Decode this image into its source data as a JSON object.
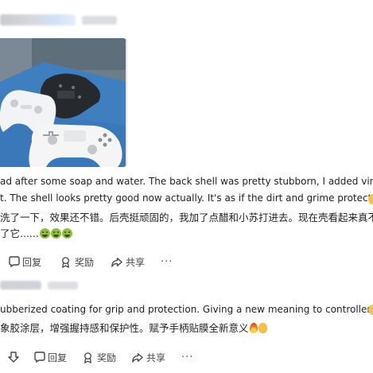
{
  "post1": {
    "text_en_line1": "ad after some soap and water. The back shell was pretty stubborn, I added vinegar an",
    "text_en_line2": "t. The shell looks pretty good now actually. It's as if the dirt and grime protected it...",
    "text_cn_line1": "洗了一下，效果还不错。后壳挺顽固的，我加了点醋和小苏打进去。现在壳看起来真不",
    "text_cn_line2": "了它......",
    "actions": {
      "like_label": "",
      "reply_label": "回复",
      "award_label": "奖励",
      "share_label": "共享",
      "more_label": "···"
    }
  },
  "post2": {
    "text_en": "ubberized coating for grip and protection. Giving a new meaning to controller skin",
    "text_cn": "象胶涂层，增强握持感和保护性。赋予手柄贴膜全新意义",
    "actions": {
      "like_label": "",
      "reply_label": "回复",
      "award_label": "奖励",
      "share_label": "共享",
      "more_label": "···"
    }
  },
  "icons": {
    "comment": "comment-icon",
    "downvote": "downvote-icon",
    "award": "award-icon",
    "share": "share-icon"
  },
  "colors": {
    "text": "#222222",
    "muted": "#444444",
    "mat_blue": "#3f7fc0"
  }
}
